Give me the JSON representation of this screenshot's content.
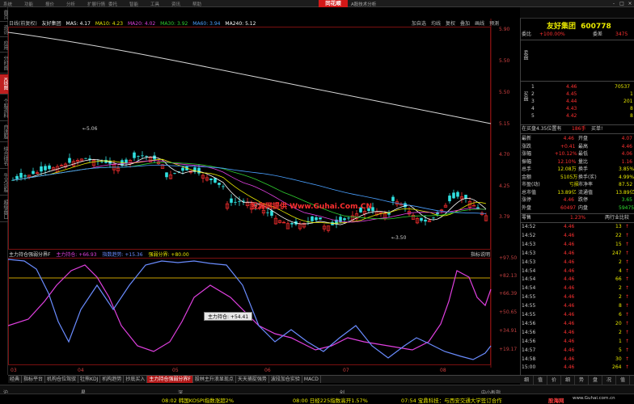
{
  "menu": [
    "系统",
    "功能",
    "报价",
    "分析",
    "扩展行情",
    "委托",
    "智能",
    "工具",
    "资讯",
    "帮助"
  ],
  "brand": "同花顺",
  "subtitle": "A股技术分析",
  "window_buttons": [
    "-",
    "□",
    "×"
  ],
  "left_tabs": [
    {
      "label": "首页",
      "active": false
    },
    {
      "label": "资讯",
      "active": false
    },
    {
      "label": "应用",
      "active": false
    },
    {
      "label": "分时图",
      "active": false
    },
    {
      "label": "K线图",
      "active": true
    },
    {
      "label": "个股资料",
      "active": false
    },
    {
      "label": "自选股",
      "active": false
    },
    {
      "label": "综合排名",
      "active": false
    },
    {
      "label": "牛叉诊股",
      "active": false
    },
    {
      "label": "超级盘口",
      "active": false
    }
  ],
  "kline_info": {
    "period": "日线(前复权)",
    "name": "友好集团",
    "ma5": "MA5: 4.17",
    "ma10": "MA10: 4.23",
    "ma20": "MA20: 4.02",
    "ma30": "MA30: 3.92",
    "ma60": "MA60: 3.94",
    "ma240": "MA240: 5.12"
  },
  "chart_buttons": [
    "加自选",
    "均线",
    "复权",
    "叠加",
    "画线",
    "预测"
  ],
  "price_axis": [
    "5.90",
    "5.50",
    "5.15",
    "4.70",
    "4.25",
    "3.79"
  ],
  "annotations": {
    "high": "5.06",
    "low": "3.50"
  },
  "watermark": "股海网提供 Www.Guhai.Com.CN",
  "indicator": {
    "name": "主力持仓强弱分界F",
    "line1": "主力持仓: +66.93",
    "line2": "指数趋势: +15.36",
    "line3": "强弱分界: +80.00",
    "explain": "指标说明",
    "tooltip": "主力持仓: +54.41"
  },
  "ind_axis": [
    "+97.50",
    "+82.13",
    "+66.39",
    "+50.65",
    "+34.91",
    "+19.17"
  ],
  "date_axis": [
    "03",
    "04",
    "05",
    "06",
    "07",
    "08"
  ],
  "bottom_tabs": [
    {
      "label": "经典",
      "active": false
    },
    {
      "label": "指标平台",
      "active": false
    },
    {
      "label": "机构仓位驾驭",
      "active": false
    },
    {
      "label": "牡熊KDJ",
      "active": false
    },
    {
      "label": "机构趋势",
      "active": false
    },
    {
      "label": "抄底买入",
      "active": false
    },
    {
      "label": "主力持仓强弱分界F",
      "active": true
    },
    {
      "label": "股林主升浪显现点",
      "active": false
    },
    {
      "label": "天天捕捉强势",
      "active": false
    },
    {
      "label": "波段加仓实验",
      "active": false
    },
    {
      "label": "MACD",
      "active": false
    }
  ],
  "stock": {
    "name": "友好集团",
    "code": "600778"
  },
  "order_book": {
    "weibi_label": "委比",
    "weibi": "+100.00%",
    "weicha_label": "委差",
    "weicha": "3475",
    "sell_label": "卖盘",
    "buy_label": "买盘",
    "buy1": {
      "label": "1",
      "price": "4.46",
      "vol": "70537"
    },
    "buy_rows": [
      {
        "label": "2",
        "price": "4.45",
        "vol": "1"
      },
      {
        "label": "3",
        "price": "4.44",
        "vol": "201"
      },
      {
        "label": "4",
        "price": "4.43",
        "vol": "8"
      },
      {
        "label": "5",
        "price": "4.42",
        "vol": "8"
      }
    ]
  },
  "limit_line": {
    "text": "在买盘4.35位置有",
    "vol": "186手",
    "action": "买单!"
  },
  "quote_rows": [
    [
      {
        "l": "最新",
        "v": "4.46",
        "c": "#ff3030"
      },
      {
        "l": "开盘",
        "v": "4.07",
        "c": "#ff3030"
      }
    ],
    [
      {
        "l": "涨跌",
        "v": "+0.41",
        "c": "#ff3030"
      },
      {
        "l": "最高",
        "v": "4.46",
        "c": "#ff3030"
      }
    ],
    [
      {
        "l": "涨幅",
        "v": "+10.12%",
        "c": "#ff3030"
      },
      {
        "l": "最低",
        "v": "4.06",
        "c": "#ff3030"
      }
    ],
    [
      {
        "l": "振幅",
        "v": "12.10%",
        "c": "#ff3030"
      },
      {
        "l": "量比",
        "v": "1.16",
        "c": "#ff3030"
      }
    ],
    [
      {
        "l": "总手",
        "v": "12.08万",
        "c": "#e8e800"
      },
      {
        "l": "换手",
        "v": "3.85%",
        "c": "#e8e800"
      }
    ],
    [
      {
        "l": "金额",
        "v": "5105万",
        "c": "#e8e800"
      },
      {
        "l": "换手(实)",
        "v": "4.99%",
        "c": "#e8e800"
      }
    ],
    [
      {
        "l": "市盈(动)",
        "v": "亏损",
        "c": "#e8e800"
      },
      {
        "l": "市净率",
        "v": "87.52",
        "c": "#e8e800"
      }
    ],
    [
      {
        "l": "总市值",
        "v": "13.89亿",
        "c": "#e8e800"
      },
      {
        "l": "流通值",
        "v": "13.89亿",
        "c": "#e8e800"
      }
    ],
    [
      {
        "l": "涨停",
        "v": "4.46",
        "c": "#ff3030"
      },
      {
        "l": "跌停",
        "v": "3.65",
        "c": "#30e030"
      }
    ],
    [
      {
        "l": "外盘",
        "v": "60497",
        "c": "#ff3030"
      },
      {
        "l": "内盘",
        "v": "59475",
        "c": "#30e030"
      }
    ]
  ],
  "zero_row": {
    "label": "零售",
    "pct": "1.23%",
    "extra": "两行业比较"
  },
  "ticks": [
    {
      "t": "14:52",
      "p": "4.46",
      "v": "13",
      "f": "↑"
    },
    {
      "t": "14:52",
      "p": "4.46",
      "v": "22",
      "f": "↑"
    },
    {
      "t": "14:53",
      "p": "4.46",
      "v": "15",
      "f": "↑"
    },
    {
      "t": "14:53",
      "p": "4.46",
      "v": "247",
      "f": "↑"
    },
    {
      "t": "14:53",
      "p": "4.46",
      "v": "2",
      "f": "↑"
    },
    {
      "t": "14:54",
      "p": "4.46",
      "v": "4",
      "f": "↑"
    },
    {
      "t": "14:54",
      "p": "4.46",
      "v": "66",
      "f": "↑"
    },
    {
      "t": "14:54",
      "p": "4.46",
      "v": "2",
      "f": "↑"
    },
    {
      "t": "14:55",
      "p": "4.46",
      "v": "2",
      "f": "↑"
    },
    {
      "t": "14:55",
      "p": "4.46",
      "v": "8",
      "f": "↑"
    },
    {
      "t": "14:55",
      "p": "4.46",
      "v": "6",
      "f": "↑"
    },
    {
      "t": "14:56",
      "p": "4.46",
      "v": "20",
      "f": "↑"
    },
    {
      "t": "14:56",
      "p": "4.46",
      "v": "2",
      "f": "↑"
    },
    {
      "t": "14:56",
      "p": "4.46",
      "v": "1",
      "f": "↑"
    },
    {
      "t": "14:57",
      "p": "4.46",
      "v": "5",
      "f": "↑"
    },
    {
      "t": "14:58",
      "p": "4.46",
      "v": "30",
      "f": "↑"
    },
    {
      "t": "15:00",
      "p": "4.46",
      "v": "264",
      "f": "↑"
    }
  ],
  "right_bottom_tabs": [
    "细",
    "值",
    "价",
    "细",
    "势",
    "盘",
    "况",
    "值"
  ],
  "small_board": "中小板指",
  "status_items": [
    "沪",
    "星",
    "深",
    "创",
    "中小板指"
  ],
  "news": [
    {
      "text": "08:02 韩国KOSPI指数涨超2%",
      "c": "#e8e800"
    },
    {
      "text": "08:00 日经225指数高开1.57%",
      "c": "#e8e800"
    },
    {
      "text": "07:54 宝鼎科技：与西安交通大学签订合作",
      "c": "#e8e800"
    }
  ],
  "footer_logo": "股海网",
  "footer_url": "www.Guhai.com.cn",
  "colors": {
    "up": "#ff3030",
    "down": "#30e0e0",
    "magenta": "#e040e0",
    "blue": "#6a8cff",
    "yellow": "#e8e800"
  }
}
